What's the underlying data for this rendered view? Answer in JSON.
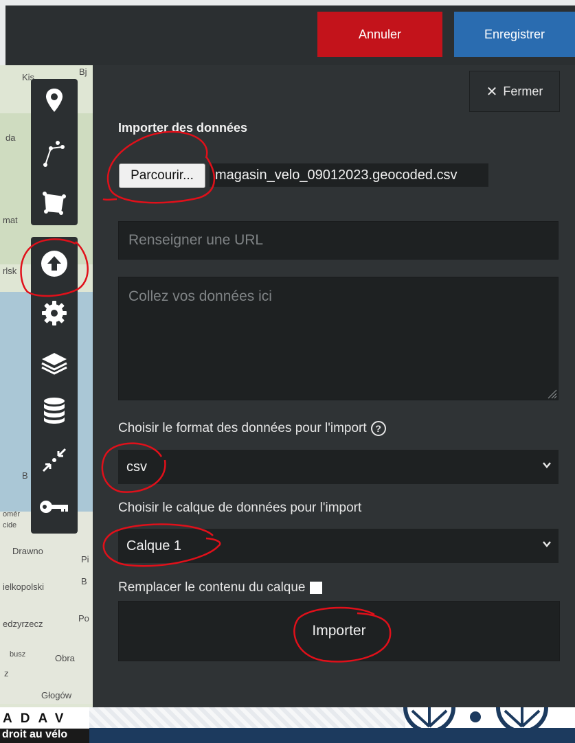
{
  "topbar": {
    "cancel_label": "Annuler",
    "save_label": "Enregistrer"
  },
  "map": {
    "labels": [
      "Kis",
      "Bj",
      "da",
      "mat",
      "rlsk",
      "B",
      "omér",
      "cide",
      "Drawno",
      "Pi",
      "ielkopolski",
      "B",
      "edzyrzecz",
      "Po",
      "busz",
      "Obra",
      "z",
      "Głogów"
    ]
  },
  "toolbar": {
    "items": [
      "marker-icon",
      "polyline-icon",
      "polygon-icon",
      "upload-icon",
      "settings-icon",
      "layers-icon",
      "database-icon",
      "center-map-icon",
      "key-icon"
    ]
  },
  "panel": {
    "close_label": "Fermer",
    "title": "Importer des données",
    "browse_label": "Parcourir...",
    "file_name": "magasin_velo_09012023.geocoded.csv",
    "url_placeholder": "Renseigner une URL",
    "paste_placeholder": "Collez vos données ici",
    "format_label": "Choisir le format des données pour l'import",
    "format_value": "csv",
    "layer_label": "Choisir le calque de données pour l'import",
    "layer_value": "Calque 1",
    "replace_label": "Remplacer le contenu du calque",
    "import_label": "Importer"
  },
  "footer": {
    "logo_top": "ADAV",
    "logo_bottom": "droit au vélo"
  },
  "colors": {
    "cancel": "#c3131b",
    "save": "#2a6cb0",
    "panel": "#2f3335",
    "annotation": "#e0101a"
  }
}
